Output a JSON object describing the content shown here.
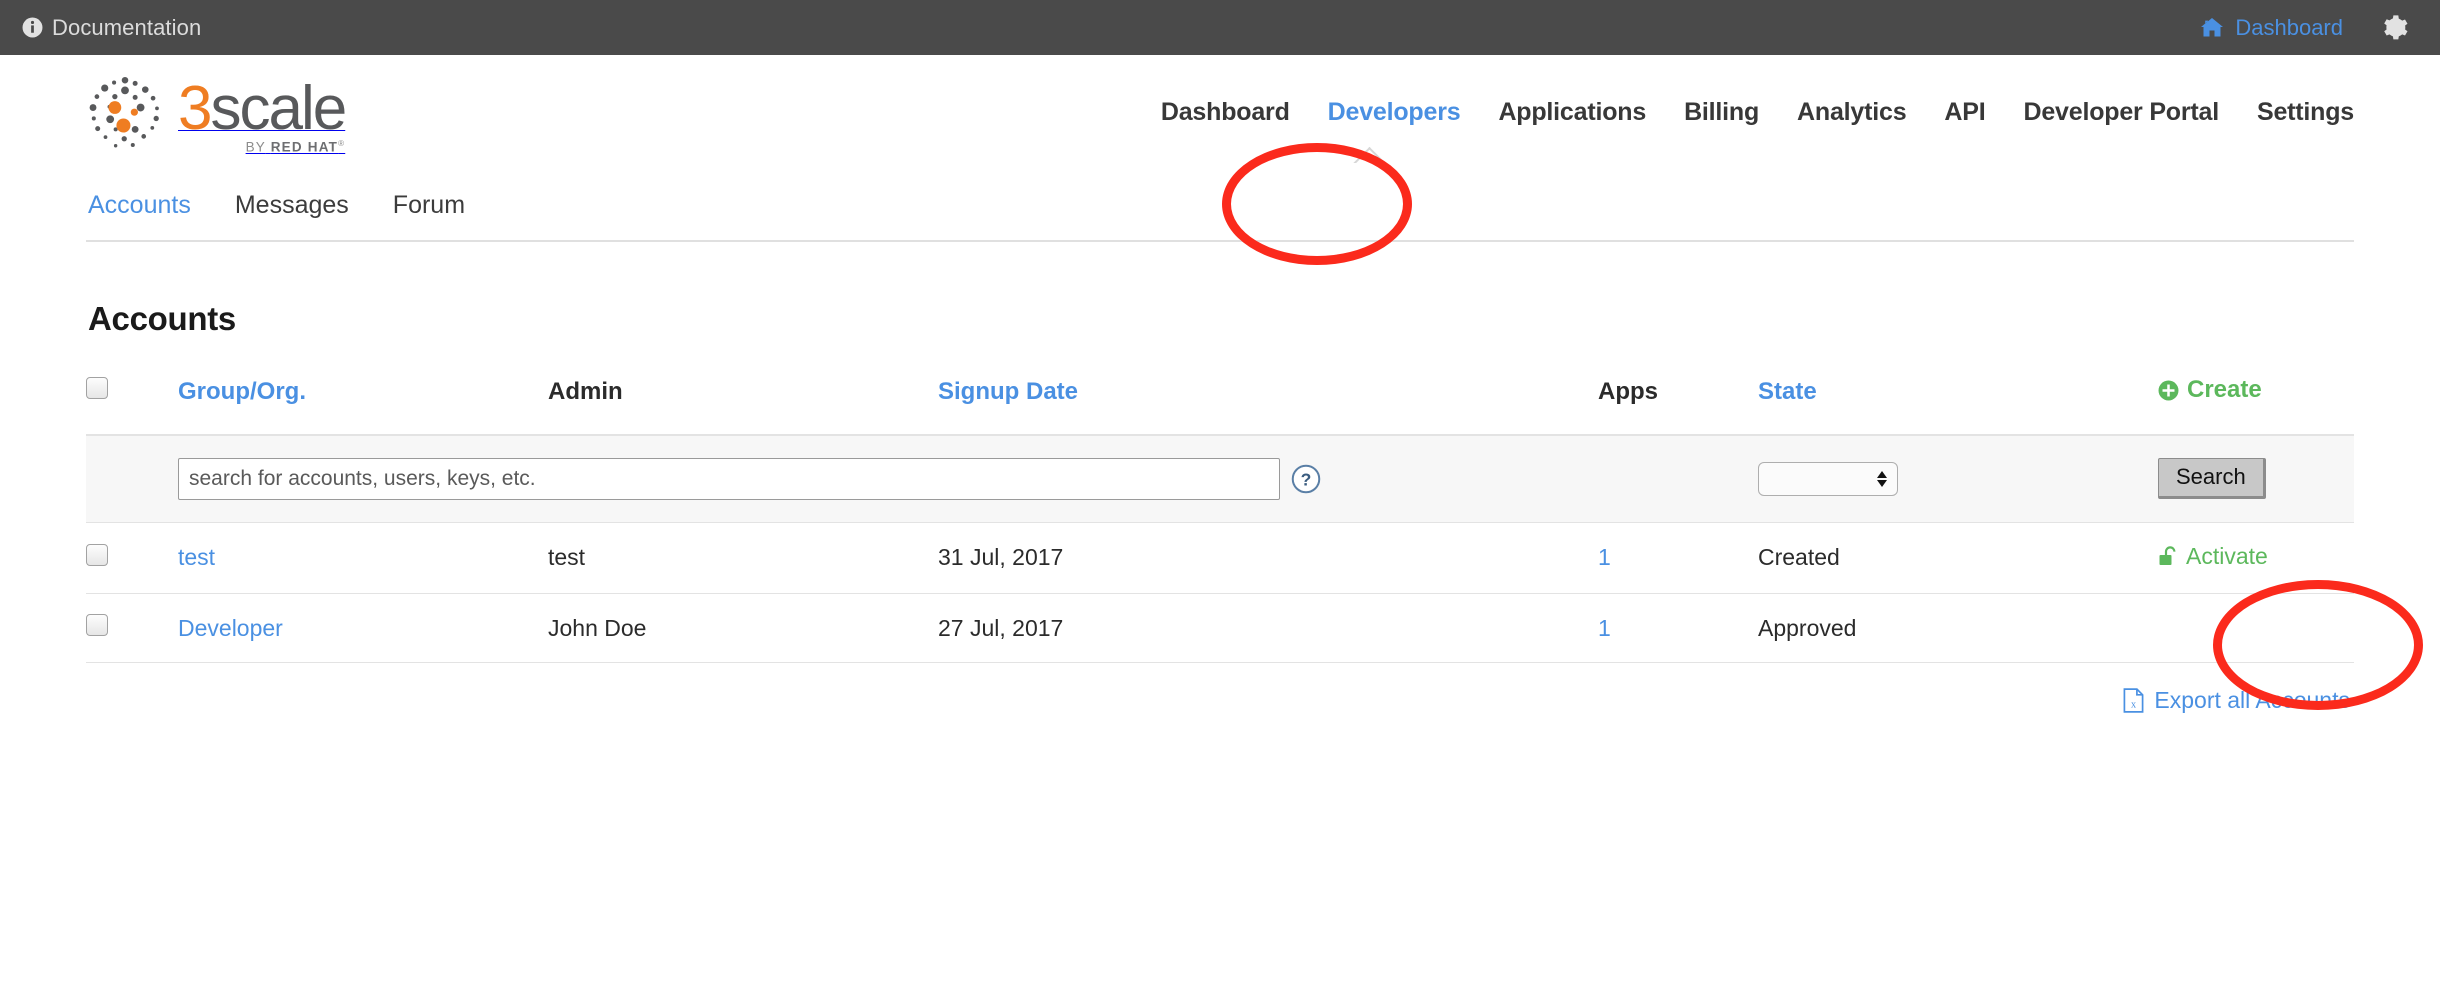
{
  "admin_bar": {
    "doc_label": "Documentation",
    "doc_icon": "info-circle-icon",
    "dashboard_label": "Dashboard",
    "dashboard_icon": "home-icon",
    "settings_icon": "gear-icon",
    "background": "#4a4a4a",
    "link_color": "#4a90e2"
  },
  "logo": {
    "word_3": "3",
    "word_scale": "scale",
    "by": "BY",
    "redhat": "RED HAT",
    "trademark": "®",
    "orange": "#ef7d22",
    "gray": "#58595b"
  },
  "main_nav": {
    "items": [
      {
        "label": "Dashboard",
        "active": false
      },
      {
        "label": "Developers",
        "active": true
      },
      {
        "label": "Applications",
        "active": false
      },
      {
        "label": "Billing",
        "active": false
      },
      {
        "label": "Analytics",
        "active": false
      },
      {
        "label": "API",
        "active": false
      },
      {
        "label": "Developer Portal",
        "active": false
      },
      {
        "label": "Settings",
        "active": false
      }
    ]
  },
  "sub_nav": {
    "items": [
      {
        "label": "Accounts",
        "active": true
      },
      {
        "label": "Messages",
        "active": false
      },
      {
        "label": "Forum",
        "active": false
      }
    ]
  },
  "main": {
    "title": "Accounts",
    "create_label": "Create",
    "create_icon": "plus-circle-icon",
    "export_label": "Export all Accounts",
    "export_icon": "excel-file-icon",
    "columns": [
      {
        "label": "Group/Org.",
        "sortable": true
      },
      {
        "label": "Admin",
        "sortable": false
      },
      {
        "label": "Signup Date",
        "sortable": true
      },
      {
        "label": "Apps",
        "sortable": false
      },
      {
        "label": "State",
        "sortable": true
      }
    ],
    "search": {
      "value": "",
      "placeholder": "search for accounts, users, keys, etc.",
      "help_icon": "question-circle-icon",
      "state_filter_value": "",
      "state_filter_options": [
        ""
      ],
      "button_label": "Search"
    },
    "rows": [
      {
        "group": "test",
        "admin": "test",
        "signup_date": "31 Jul, 2017",
        "apps": "1",
        "state": "Created",
        "action_label": "Activate",
        "action_icon": "unlock-icon"
      },
      {
        "group": "Developer",
        "admin": "John Doe",
        "signup_date": "27 Jul, 2017",
        "apps": "1",
        "state": "Approved",
        "action_label": "",
        "action_icon": ""
      }
    ]
  },
  "annotations": {
    "color": "#fb2a1c",
    "shapes": [
      {
        "name": "developers-nav-highlight",
        "target": "Developers"
      },
      {
        "name": "activate-link-highlight",
        "target": "Activate"
      }
    ]
  }
}
